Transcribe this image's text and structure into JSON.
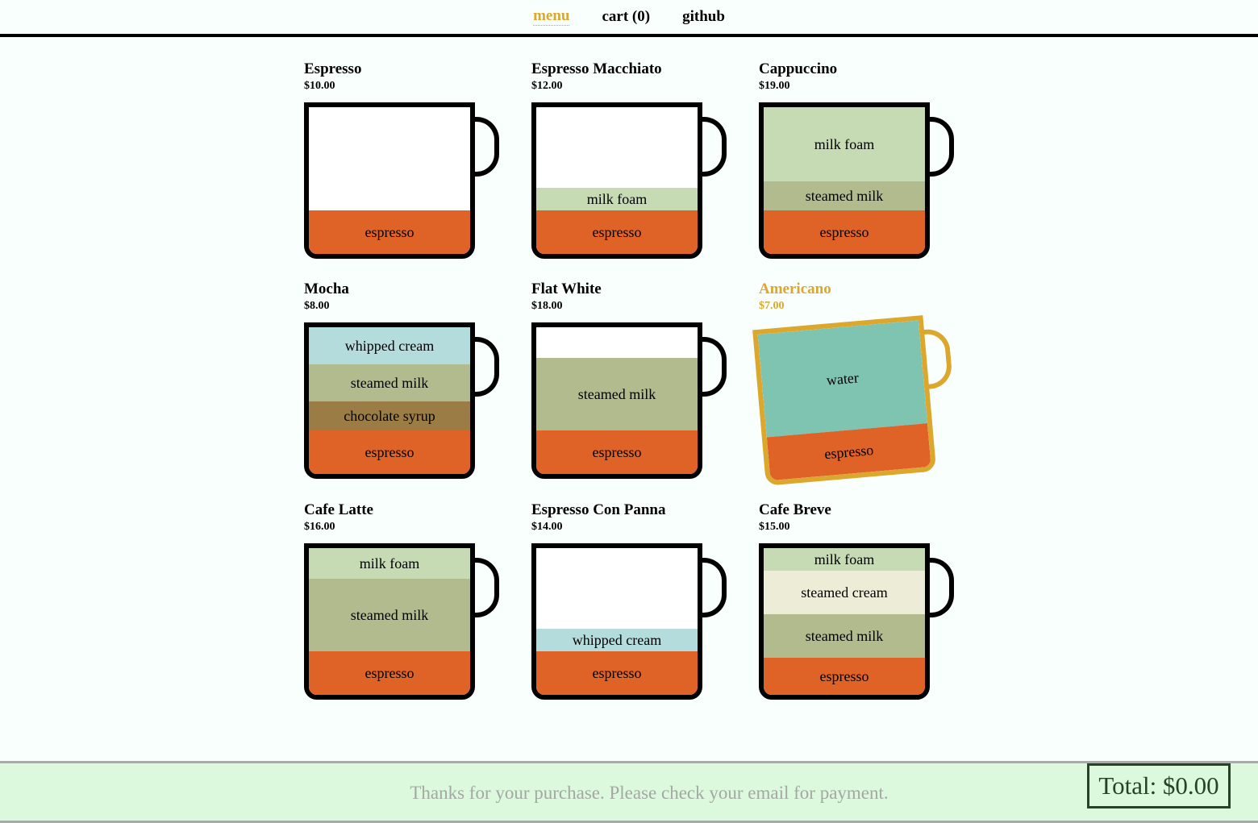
{
  "nav": {
    "menu": "menu",
    "cart": "cart (0)",
    "github": "github"
  },
  "menu": {
    "items": [
      {
        "name": "Espresso",
        "price": "$10.00",
        "layers": [
          {
            "label": "espresso",
            "type": "espresso",
            "h": 54
          }
        ]
      },
      {
        "name": "Espresso Macchiato",
        "price": "$12.00",
        "layers": [
          {
            "label": "espresso",
            "type": "espresso",
            "h": 54
          },
          {
            "label": "milk foam",
            "type": "milkfoam",
            "h": 28
          }
        ]
      },
      {
        "name": "Cappuccino",
        "price": "$19.00",
        "layers": [
          {
            "label": "espresso",
            "type": "espresso",
            "h": 54
          },
          {
            "label": "steamed milk",
            "type": "steamedmilk",
            "h": 36
          },
          {
            "label": "milk foam",
            "type": "milkfoam",
            "h": 92
          }
        ]
      },
      {
        "name": "Mocha",
        "price": "$8.00",
        "layers": [
          {
            "label": "espresso",
            "type": "espresso",
            "h": 54
          },
          {
            "label": "chocolate syrup",
            "type": "chocolatesyrup",
            "h": 36
          },
          {
            "label": "steamed milk",
            "type": "steamedmilk",
            "h": 46
          },
          {
            "label": "whipped cream",
            "type": "whippedcream",
            "h": 46
          }
        ]
      },
      {
        "name": "Flat White",
        "price": "$18.00",
        "layers": [
          {
            "label": "espresso",
            "type": "espresso",
            "h": 54
          },
          {
            "label": "steamed milk",
            "type": "steamedmilk",
            "h": 90
          }
        ]
      },
      {
        "name": "Americano",
        "price": "$7.00",
        "selected": true,
        "layers": [
          {
            "label": "espresso",
            "type": "espresso",
            "h": 54
          },
          {
            "label": "water",
            "type": "water",
            "h": 128
          }
        ]
      },
      {
        "name": "Cafe Latte",
        "price": "$16.00",
        "layers": [
          {
            "label": "espresso",
            "type": "espresso",
            "h": 54
          },
          {
            "label": "steamed milk",
            "type": "steamedmilk",
            "h": 90
          },
          {
            "label": "milk foam",
            "type": "milkfoam",
            "h": 38
          }
        ]
      },
      {
        "name": "Espresso Con Panna",
        "price": "$14.00",
        "layers": [
          {
            "label": "espresso",
            "type": "espresso",
            "h": 54
          },
          {
            "label": "whipped cream",
            "type": "whippedcream",
            "h": 28
          }
        ]
      },
      {
        "name": "Cafe Breve",
        "price": "$15.00",
        "layers": [
          {
            "label": "espresso",
            "type": "espresso",
            "h": 46
          },
          {
            "label": "steamed milk",
            "type": "steamedmilk",
            "h": 54
          },
          {
            "label": "steamed cream",
            "type": "steamedcream",
            "h": 54
          },
          {
            "label": "milk foam",
            "type": "milkfoam",
            "h": 28
          }
        ]
      }
    ]
  },
  "footer": {
    "message": "Thanks for your purchase. Please check your email for payment.",
    "total": "Total: $0.00"
  },
  "colors": {
    "accent": "#dba72c",
    "espresso": "#df6227",
    "milk_foam": "#c6dbb4",
    "steamed_milk": "#b1bb8d",
    "whipped_cream": "#b4dcdc",
    "chocolate_syrup": "#9b7c45",
    "water": "#7fc3b1",
    "steamed_cream": "#edecd6",
    "footer_bg": "#dcf8dd"
  }
}
